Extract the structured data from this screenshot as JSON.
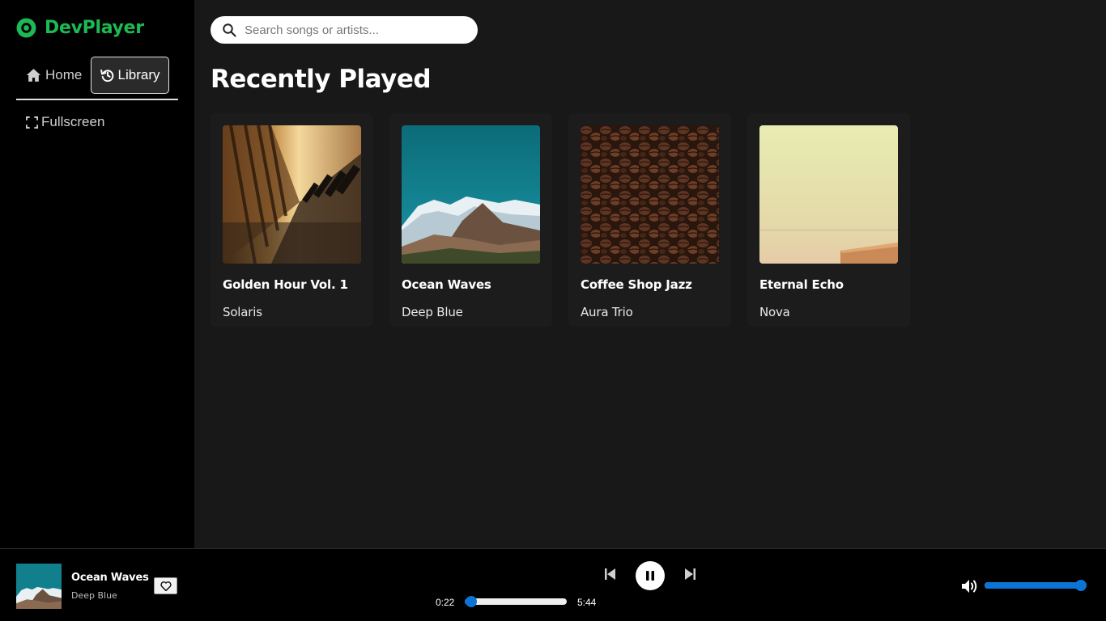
{
  "app": {
    "name": "DevPlayer",
    "accent_color": "#1db954"
  },
  "nav": {
    "home_label": "Home",
    "library_label": "Library",
    "fullscreen_label": "Fullscreen",
    "active": "Library"
  },
  "search": {
    "placeholder": "Search songs or artists...",
    "value": ""
  },
  "main": {
    "section_title": "Recently Played",
    "albums": [
      {
        "title": "Golden Hour Vol. 1",
        "artist": "Solaris",
        "cover": "sunlit-wooden-corridor"
      },
      {
        "title": "Ocean Waves",
        "artist": "Deep Blue",
        "cover": "snowy-mountain-range"
      },
      {
        "title": "Coffee Shop Jazz",
        "artist": "Aura Trio",
        "cover": "coffee-beans"
      },
      {
        "title": "Eternal Echo",
        "artist": "Nova",
        "cover": "hazy-pastel-horizon"
      }
    ]
  },
  "player": {
    "title": "Ocean Waves",
    "artist": "Deep Blue",
    "current_time": "0:22",
    "total_time": "5:44",
    "progress_fraction": 0.064,
    "volume_fraction": 1.0,
    "state": "playing",
    "slider_color": "#0b74d4"
  }
}
